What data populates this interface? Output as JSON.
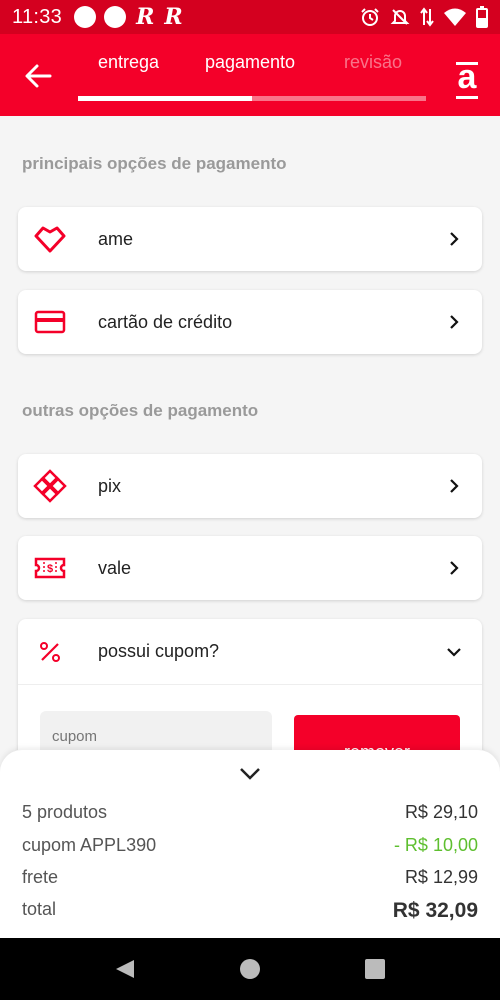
{
  "status": {
    "time": "11:33"
  },
  "header": {
    "steps": [
      {
        "label": "entrega"
      },
      {
        "label": "pagamento"
      },
      {
        "label": "revisão"
      }
    ],
    "progress": 0.5,
    "logo_letter": "a"
  },
  "sections": {
    "main_title": "principais opções de pagamento",
    "other_title": "outras opções de pagamento"
  },
  "options": {
    "ame": "ame",
    "credit_card": "cartão de crédito",
    "pix": "pix",
    "vale": "vale"
  },
  "coupon": {
    "question": "possui cupom?",
    "placeholder": "cupom",
    "remove_label": "remover"
  },
  "summary": {
    "rows": [
      {
        "label": "5 produtos",
        "value": "R$ 29,10"
      },
      {
        "label": "cupom APPL390",
        "value": "- R$ 10,00"
      },
      {
        "label": "frete",
        "value": "R$ 12,99"
      },
      {
        "label": "total",
        "value": "R$ 32,09"
      }
    ]
  },
  "colors": {
    "brand": "#f40029",
    "status_bar": "#d4001f",
    "discount": "#5ebf2f"
  },
  "icons": {
    "ame": "heart-icon",
    "credit_card": "credit-card-icon",
    "pix": "pix-icon",
    "vale": "voucher-icon",
    "coupon": "percent-icon"
  }
}
